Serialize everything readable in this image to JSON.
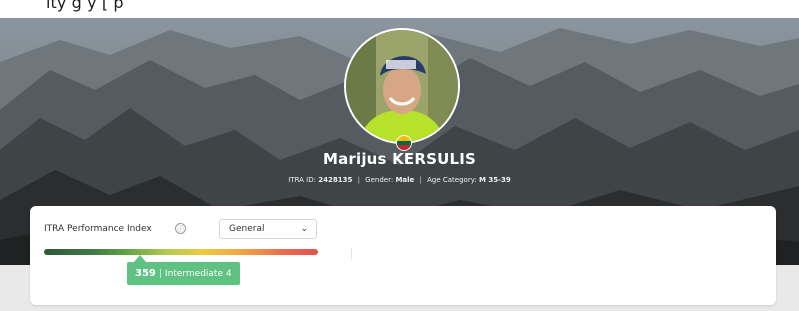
{
  "top_crop_text": "        ity        g         y        [                             p                    ",
  "profile": {
    "name": "Marijus KERSULIS",
    "itra_id_label": "ITRA ID:",
    "itra_id": "2428135",
    "gender_label": "Gender:",
    "gender": "Male",
    "age_category_label": "Age Category:",
    "age_category": "M 35-39",
    "avatar_icon": "athlete-photo",
    "flag_colors": [
      "#fdb913",
      "#006a44",
      "#c1272d"
    ]
  },
  "performance": {
    "title": "ITRA Performance Index",
    "info_icon": "ⓘ",
    "dropdown_selected": "General",
    "dropdown_chevron": "⌄",
    "score": "359",
    "level": "Intermediate 4",
    "score_color": "#60c282"
  }
}
